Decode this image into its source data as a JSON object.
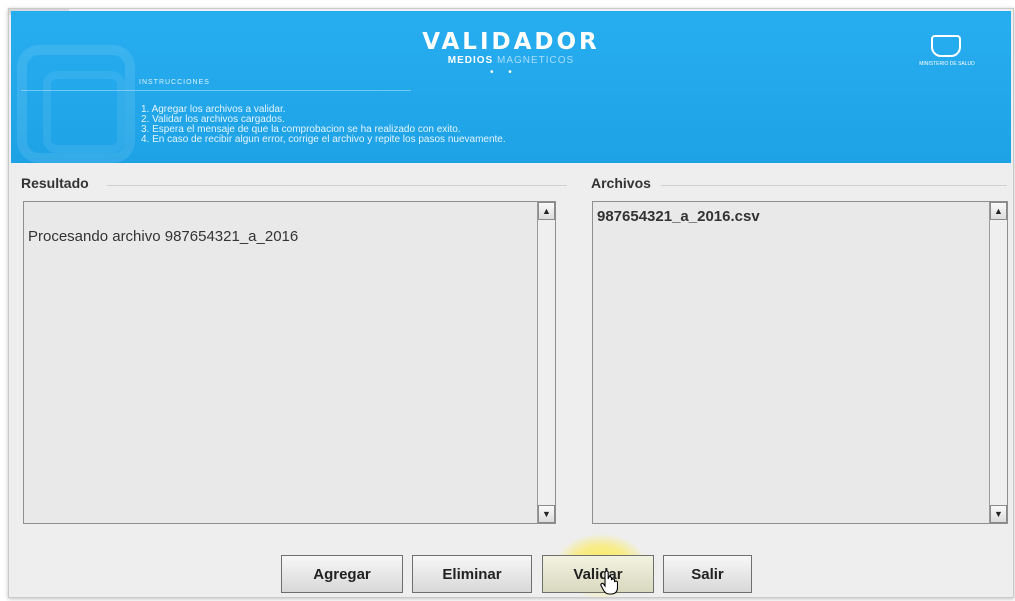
{
  "banner": {
    "title": "VALIDADOR",
    "subtitle_bold": "MEDIOS",
    "subtitle_soft": "MAGNETICOS",
    "dots": "• •",
    "instructions_title": "INSTRUCCIONES",
    "instructions": [
      "1. Agregar los archivos a validar.",
      "2. Validar los archivos cargados.",
      "3. Espera el mensaje de que la comprobacion se ha realizado con exito.",
      "4. En caso de recibir algun error, corrige el archivo y repite los pasos nuevamente."
    ],
    "logo_text": "MINISTERIO DE SALUD"
  },
  "resultado": {
    "label": "Resultado",
    "text": "Procesando archivo 987654321_a_2016"
  },
  "archivos": {
    "label": "Archivos",
    "files": [
      "987654321_a_2016.csv"
    ]
  },
  "buttons": {
    "agregar": "Agregar",
    "eliminar": "Eliminar",
    "validar": "Validar",
    "salir": "Salir"
  },
  "icons": {
    "scroll_up": "▲",
    "scroll_down": "▼"
  }
}
